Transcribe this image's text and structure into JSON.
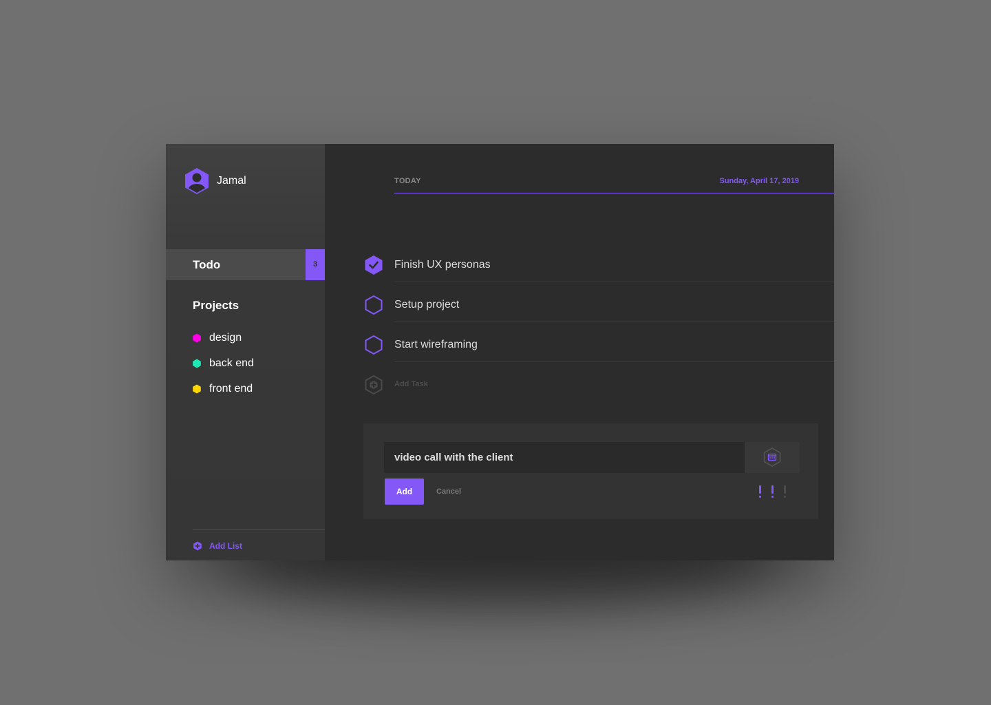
{
  "user": {
    "name": "Jamal",
    "avatar_icon": "user-hexagon-icon"
  },
  "sidebar": {
    "active_list": {
      "label": "Todo",
      "count": "3"
    },
    "projects_title": "Projects",
    "projects": [
      {
        "name": "design",
        "color": "#ff00e6"
      },
      {
        "name": "back end",
        "color": "#1de9b6"
      },
      {
        "name": "front end",
        "color": "#ffd600"
      }
    ],
    "add_list_label": "Add List"
  },
  "header": {
    "section": "TODAY",
    "date": "Sunday, April 17, 2019"
  },
  "tasks": [
    {
      "text": "Finish UX personas",
      "done": true
    },
    {
      "text": "Setup project",
      "done": false
    },
    {
      "text": "Start wireframing",
      "done": false
    }
  ],
  "add_task_label": "Add Task",
  "new_task": {
    "value": "video call with the client",
    "add_label": "Add",
    "cancel_label": "Cancel",
    "priority_level": 2,
    "calendar_icon": "calendar-icon"
  },
  "colors": {
    "accent": "#8358f7",
    "background": "#2c2c2c",
    "sidebar": "#393939"
  }
}
